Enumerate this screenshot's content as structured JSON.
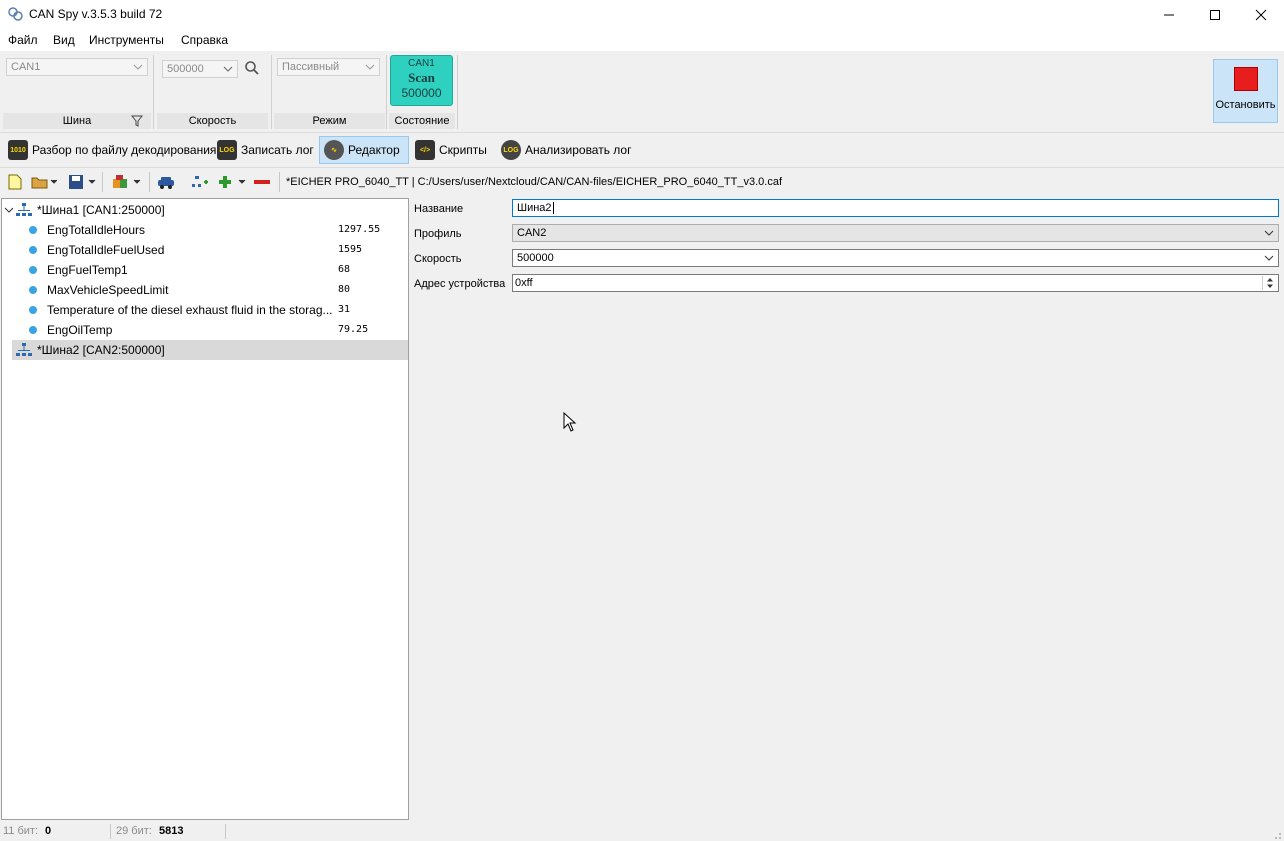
{
  "window": {
    "title": "CAN Spy v.3.5.3 build 72"
  },
  "menu": {
    "file": "Файл",
    "view": "Вид",
    "tools": "Инструменты",
    "help": "Справка"
  },
  "ribbon": {
    "bus_value": "CAN1",
    "bus_label": "Шина",
    "speed_value": "500000",
    "speed_label": "Скорость",
    "mode_value": "Пассивный",
    "mode_label": "Режим",
    "status": {
      "top": "CAN1",
      "middle": "Scan",
      "bottom": "500000",
      "label": "Состояние",
      "color": "#2ed1c0"
    },
    "stop_label": "Остановить",
    "stop_color": "#e81e1e"
  },
  "modes": {
    "decode": "Разбор по файлу декодирования",
    "record": "Записать лог",
    "editor": "Редактор",
    "scripts": "Скрипты",
    "analyze": "Анализировать лог"
  },
  "toolbar": {
    "file_path": "*EICHER PRO_6040_TT | C:/Users/user/Nextcloud/CAN/CAN-files/EICHER_PRO_6040_TT_v3.0.caf"
  },
  "tree": {
    "bus1": "*Шина1 [CAN1:250000]",
    "signals": [
      {
        "name": "EngTotalIdleHours",
        "value": "1297.55"
      },
      {
        "name": "EngTotalIdleFuelUsed",
        "value": "1595"
      },
      {
        "name": "EngFuelTemp1",
        "value": "68"
      },
      {
        "name": "MaxVehicleSpeedLimit",
        "value": "80"
      },
      {
        "name": "Temperature of the diesel exhaust fluid in the storag...",
        "value": "31"
      },
      {
        "name": "EngOilTemp",
        "value": "79.25"
      }
    ],
    "bus2": "*Шина2 [CAN2:500000]"
  },
  "props": {
    "name_label": "Название",
    "name_value": "Шина2",
    "profile_label": "Профиль",
    "profile_value": "CAN2",
    "speed_label": "Скорость",
    "speed_value": "500000",
    "address_label": "Адрес устройства",
    "address_value": "0xff"
  },
  "status": {
    "bits11_label": "11 бит:",
    "bits11_value": "0",
    "bits29_label": "29 бит:",
    "bits29_value": "5813"
  }
}
